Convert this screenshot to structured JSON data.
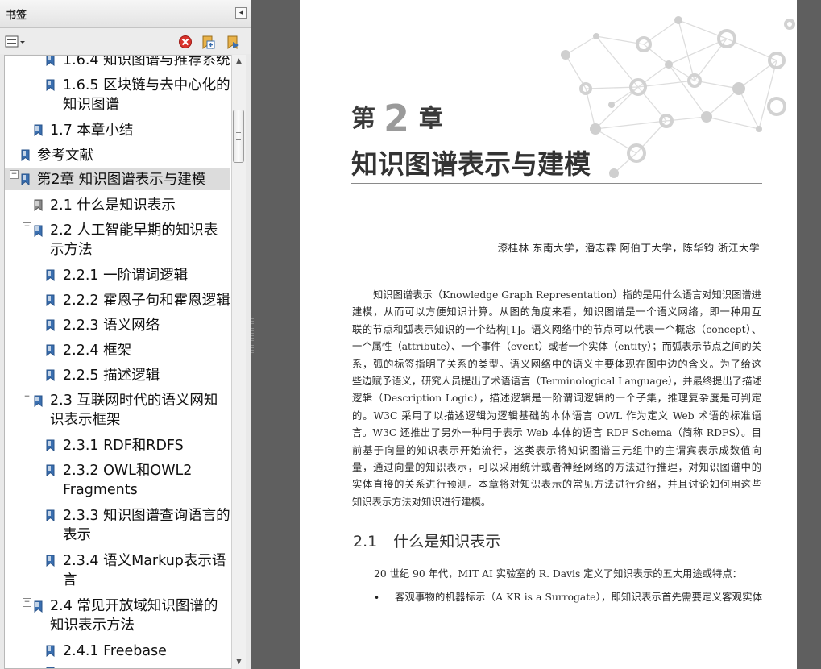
{
  "panel": {
    "title": "书签",
    "collapse_glyph": "◂",
    "toolbar": {
      "options_icon": "options-menu-icon",
      "delete_icon": "delete-bookmark-icon",
      "expand_icon": "expand-bookmark-icon",
      "collapse_icon": "new-bookmark-icon"
    },
    "scroll": {
      "up_glyph": "▲",
      "down_glyph": "▼"
    },
    "bookmarks": [
      {
        "label": "1.6.4 知识图谱与推荐系统",
        "level": 3
      },
      {
        "label_line1": "1.6.5 区块链与去中心化的",
        "label_line2": "知识图谱",
        "level": 3
      },
      {
        "label": "1.7 本章小结",
        "level": 2
      },
      {
        "label": "参考文献",
        "level": 1
      },
      {
        "label": "第2章 知识图谱表示与建模",
        "level": 1,
        "selected": true,
        "toggle": "−"
      },
      {
        "label": "2.1 什么是知识表示",
        "level": 2
      },
      {
        "label_line1": "2.2 人工智能早期的知识表",
        "label_line2": "示方法",
        "level": 2,
        "toggle": "−"
      },
      {
        "label": "2.2.1 一阶谓词逻辑",
        "level": 3
      },
      {
        "label": "2.2.2 霍恩子句和霍恩逻辑",
        "level": 3
      },
      {
        "label": "2.2.3 语义网络",
        "level": 3
      },
      {
        "label": "2.2.4 框架",
        "level": 3
      },
      {
        "label": "2.2.5 描述逻辑",
        "level": 3
      },
      {
        "label_line1": "2.3 互联网时代的语义网知",
        "label_line2": "识表示框架",
        "level": 2,
        "toggle": "−"
      },
      {
        "label": "2.3.1 RDF和RDFS",
        "level": 3
      },
      {
        "label_line1": "2.3.2 OWL和OWL2",
        "label_line2": "Fragments",
        "level": 3
      },
      {
        "label_line1": "2.3.3 知识图谱查询语言的",
        "label_line2": "表示",
        "level": 3
      },
      {
        "label_line1": "2.3.4 语义Markup表示语",
        "label_line2": "言",
        "level": 3
      },
      {
        "label_line1": "2.4 常见开放域知识图谱的",
        "label_line2": "知识表示方法",
        "level": 2,
        "toggle": "−"
      },
      {
        "label": "2.4.1 Freebase",
        "level": 3
      }
    ]
  },
  "document": {
    "chapter_prefix": "第",
    "chapter_number": "2",
    "chapter_suffix": "章",
    "chapter_title": "知识图谱表示与建模",
    "authors": "漆桂林  东南大学，潘志霖  阿伯丁大学，陈华钧  浙江大学",
    "intro_lines": [
      "知识图谱表示（Knowledge Graph Representation）指的是用什么语言对知识图谱进行",
      "建模，从而可以方便知识计算。从图的角度来看，知识图谱是一个语义网络，即一种用互",
      "联的节点和弧表示知识的一个结构[1]。语义网络中的节点可以代表一个概念（concept）、",
      "一个属性（attribute）、一个事件（event）或者一个实体（entity）；而弧表示节点之间的关",
      "系，弧的标签指明了关系的类型。语义网络中的语义主要体现在图中边的含义。为了给这",
      "些边赋予语义，研究人员提出了术语语言（Terminological Language），并最终提出了描述",
      "逻辑（Description Logic），描述逻辑是一阶谓词逻辑的一个子集，推理复杂度是可判定",
      "的。W3C 采用了以描述逻辑为逻辑基础的本体语言 OWL 作为定义 Web 术语的标准语",
      "言。W3C 还推出了另外一种用于表示 Web 本体的语言 RDF Schema（简称 RDFS）。目",
      "前基于向量的知识表示开始流行，这类表示将知识图谱三元组中的主谓宾表示成数值向",
      "量，通过向量的知识表示，可以采用统计或者神经网络的方法进行推理，对知识图谱中的",
      "实体直接的关系进行预测。本章将对知识表示的常见方法进行介绍，并且讨论如何用这些",
      "知识表示方法对知识进行建模。"
    ],
    "section_number": "2.1",
    "section_title": "什么是知识表示",
    "section_paragraph": "20 世纪 90 年代，MIT AI 实验室的 R. Davis 定义了知识表示的五大用途或特点：",
    "bullet_glyph": "•",
    "bullet_text": "客观事物的机器标示（A KR is a Surrogate），即知识表示首先需要定义客观实体"
  },
  "colors": {
    "panel_bg": "#e9e9e9",
    "viewer_bg": "#5f5f5f",
    "selected_bg": "#dcdcdc",
    "delete_red": "#d9322b",
    "bookmark_blue": "#3a6fb0"
  }
}
